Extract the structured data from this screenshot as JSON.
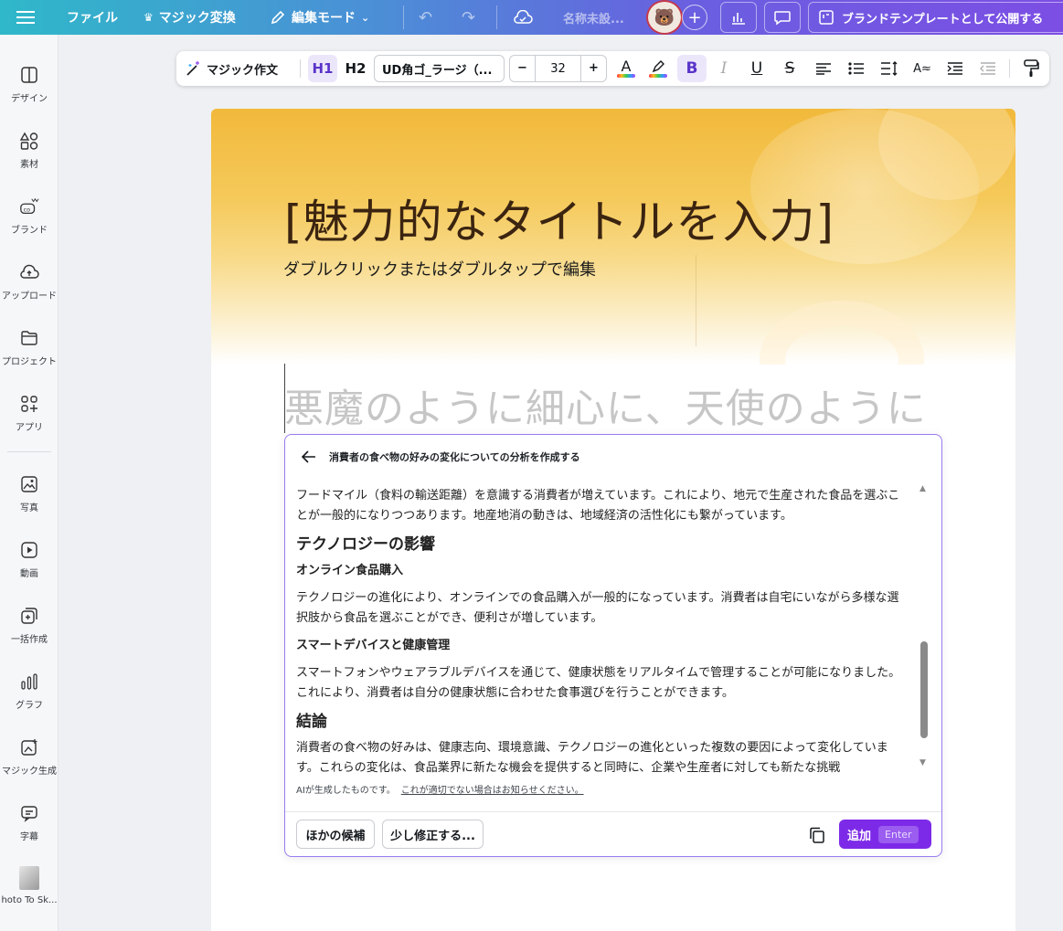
{
  "topbar": {
    "file": "ファイル",
    "magic_switch": "マジック変換",
    "edit_mode": "編集モード",
    "doc_name": "名称未設...",
    "publish": "ブランドテンプレートとして公開する"
  },
  "sidebar": {
    "items": [
      {
        "label": "デザイン",
        "icon": "layout-icon"
      },
      {
        "label": "素材",
        "icon": "shapes-icon"
      },
      {
        "label": "ブランド",
        "icon": "brand-icon"
      },
      {
        "label": "アップロード",
        "icon": "upload-icon"
      },
      {
        "label": "プロジェクト",
        "icon": "folder-icon"
      },
      {
        "label": "アプリ",
        "icon": "apps-icon"
      },
      {
        "label": "写真",
        "icon": "photo-icon"
      },
      {
        "label": "動画",
        "icon": "video-icon"
      },
      {
        "label": "一括作成",
        "icon": "bulk-create-icon"
      },
      {
        "label": "グラフ",
        "icon": "chart-icon"
      },
      {
        "label": "マジック生成",
        "icon": "magic-media-icon"
      },
      {
        "label": "字幕",
        "icon": "captions-icon"
      },
      {
        "label": "hoto To Sk...",
        "icon": "app-thumbnail-icon"
      }
    ]
  },
  "text_toolbar": {
    "magic_write": "マジック作文",
    "h1": "H1",
    "h2": "H2",
    "font_name": "UD角ゴ_ラージ（...",
    "font_size": "32",
    "minus": "−",
    "plus": "+"
  },
  "canvas": {
    "title": "[魅力的なタイトルを入力]",
    "subtitle": "ダブルクリックまたはダブルタップで編集",
    "body_placeholder": "悪魔のように細心に、天使のように"
  },
  "magic_write_panel": {
    "prompt": "消費者の食べ物の好みの変化についての分析を作成する",
    "paragraph_1": "フードマイル（食料の輸送距離）を意識する消費者が増えています。これにより、地元で生産された食品を選ぶことが一般的になりつつあります。地産地消の動きは、地域経済の活性化にも繋がっています。",
    "heading_tech": "テクノロジーの影響",
    "sub_online": "オンライン食品購入",
    "paragraph_online": "テクノロジーの進化により、オンラインでの食品購入が一般的になっています。消費者は自宅にいながら多様な選択肢から食品を選ぶことができ、便利さが増しています。",
    "sub_smart": "スマートデバイスと健康管理",
    "paragraph_smart": "スマートフォンやウェアラブルデバイスを通じて、健康状態をリアルタイムで管理することが可能になりました。これにより、消費者は自分の健康状態に合わせた食事選びを行うことができます。",
    "heading_conclusion": "結論",
    "paragraph_conclusion": "消費者の食べ物の好みは、健康志向、環境意識、テクノロジーの進化といった複数の要因によって変化しています。これらの変化は、食品業界に新たな機会を提供すると同時に、企業や生産者に対しても新たな挑戦",
    "ai_note": "AIが生成したものです。",
    "report_link": "これが適切でない場合はお知らせください。",
    "other_candidates": "ほかの候補",
    "tweak": "少し修正する...",
    "add": "追加",
    "add_shortcut": "Enter"
  }
}
